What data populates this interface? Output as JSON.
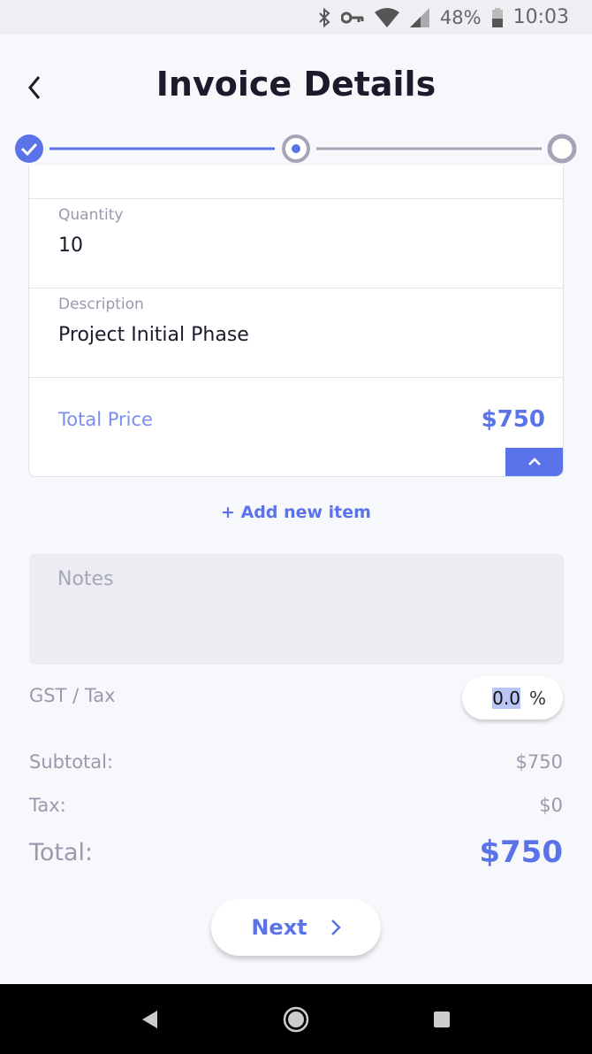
{
  "status_bar": {
    "battery": "48%",
    "time": "10:03",
    "icons": [
      "bluetooth-icon",
      "vpn-key-icon",
      "wifi-icon",
      "cell-signal-icon",
      "battery-icon"
    ]
  },
  "header": {
    "title": "Invoice Details",
    "back_icon": "chevron-left-icon"
  },
  "stepper": {
    "steps": [
      {
        "state": "completed"
      },
      {
        "state": "current"
      },
      {
        "state": "pending"
      }
    ]
  },
  "item": {
    "quantity_label": "Quantity",
    "quantity_value": "10",
    "description_label": "Description",
    "description_value": "Project Initial Phase",
    "total_price_label": "Total Price",
    "total_price_value": "$750"
  },
  "add_item_label": "+ Add new item",
  "notes_placeholder": "Notes",
  "tax": {
    "label": "GST / Tax",
    "value": "0.0",
    "unit": "%"
  },
  "summary": {
    "subtotal_label": "Subtotal:",
    "subtotal_value": "$750",
    "tax_label": "Tax:",
    "tax_value": "$0",
    "total_label": "Total:",
    "total_value": "$750"
  },
  "next_label": "Next",
  "colors": {
    "accent": "#5b73e8",
    "muted": "#9a9aac",
    "background": "#f7f8fc"
  }
}
